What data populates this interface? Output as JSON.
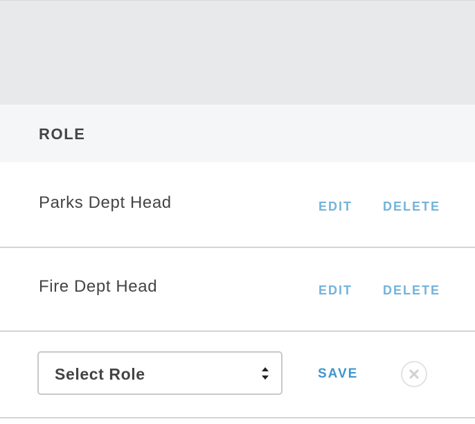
{
  "table": {
    "header": "ROLE",
    "rows": [
      {
        "name": "Parks Dept Head",
        "edit_label": "EDIT",
        "delete_label": "DELETE"
      },
      {
        "name": "Fire Dept Head",
        "edit_label": "EDIT",
        "delete_label": "DELETE"
      }
    ],
    "new_row": {
      "select_value": "Select Role",
      "save_label": "SAVE",
      "close_icon": "close-icon"
    }
  },
  "colors": {
    "link": "#74b3da",
    "save": "#3f96cc",
    "top_band": "#e8e9ea",
    "header_bg": "#f5f6f7"
  }
}
